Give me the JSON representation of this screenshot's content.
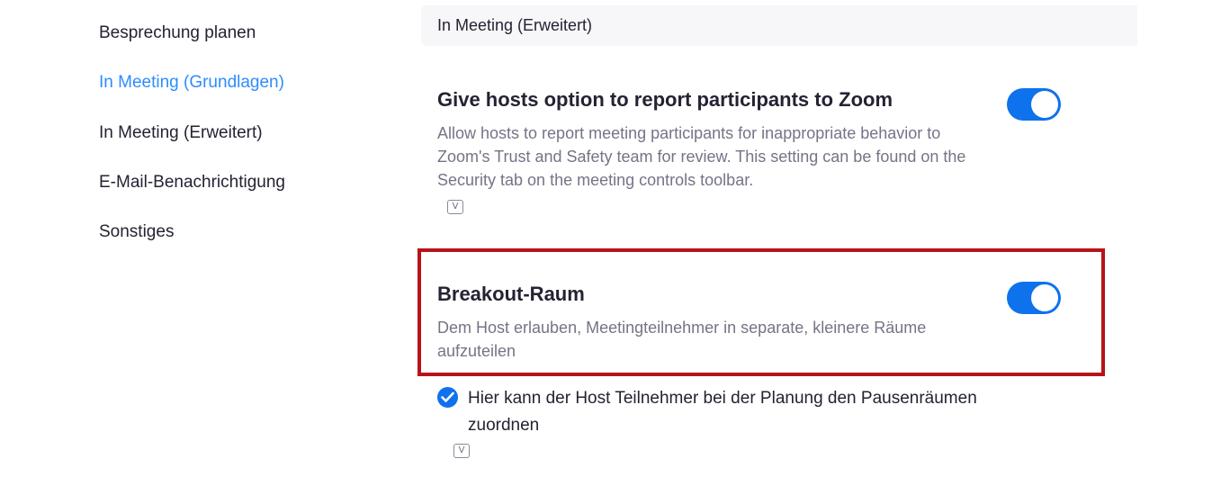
{
  "sidebar": {
    "items": [
      {
        "label": "Besprechung planen",
        "active": false
      },
      {
        "label": "In Meeting (Grundlagen)",
        "active": true
      },
      {
        "label": "In Meeting (Erweitert)",
        "active": false
      },
      {
        "label": "E-Mail-Benachrichtigung",
        "active": false
      },
      {
        "label": "Sonstiges",
        "active": false
      }
    ]
  },
  "section": {
    "title": "In Meeting (Erweitert)"
  },
  "settings": [
    {
      "title": "Give hosts option to report participants to Zoom",
      "description": "Allow hosts to report meeting participants for inappropriate behavior to Zoom's Trust and Safety team for review. This setting can be found on the Security tab on the meeting controls toolbar.",
      "enabled": true,
      "version_icon": "V"
    },
    {
      "title": "Breakout-Raum",
      "description": "Dem Host erlauben, Meetingteilnehmer in separate, kleinere Räume aufzuteilen",
      "enabled": true,
      "highlighted": true
    }
  ],
  "suboption": {
    "label": "Hier kann der Host Teilnehmer bei der Planung den Pausenräumen zuordnen",
    "checked": true,
    "version_icon": "V"
  },
  "colors": {
    "accent": "#0e72ed",
    "active_nav": "#2d8cff",
    "highlight_border": "#b7131a"
  },
  "icons": {
    "version": "version-badge-icon",
    "check": "checkmark-icon"
  }
}
